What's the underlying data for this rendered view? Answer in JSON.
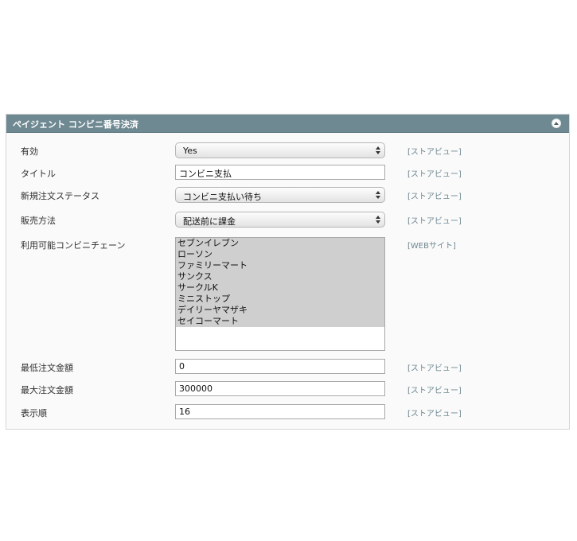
{
  "panel": {
    "title": "ペイジェント コンビニ番号決済",
    "collapse_icon": "collapse-up-icon"
  },
  "fields": {
    "enabled": {
      "label": "有効",
      "value": "Yes",
      "scope": "[ストアビュー]"
    },
    "title": {
      "label": "タイトル",
      "value": "コンビニ支払",
      "scope": "[ストアビュー]"
    },
    "order_status": {
      "label": "新規注文ステータス",
      "value": "コンビニ支払い待ち",
      "scope": "[ストアビュー]"
    },
    "sales_method": {
      "label": "販売方法",
      "value": "配送前に課金",
      "scope": "[ストアビュー]"
    },
    "chains": {
      "label": "利用可能コンビニチェーン",
      "scope": "[WEBサイト]",
      "options": [
        "セブンイレブン",
        "ローソン",
        "ファミリーマート",
        "サンクス",
        "サークルK",
        "ミニストップ",
        "デイリーヤマザキ",
        "セイコーマート"
      ]
    },
    "min_total": {
      "label": "最低注文金額",
      "value": "0",
      "scope": "[ストアビュー]"
    },
    "max_total": {
      "label": "最大注文金額",
      "value": "300000",
      "scope": "[ストアビュー]"
    },
    "sort_order": {
      "label": "表示順",
      "value": "16",
      "scope": "[ストアビュー]"
    }
  }
}
